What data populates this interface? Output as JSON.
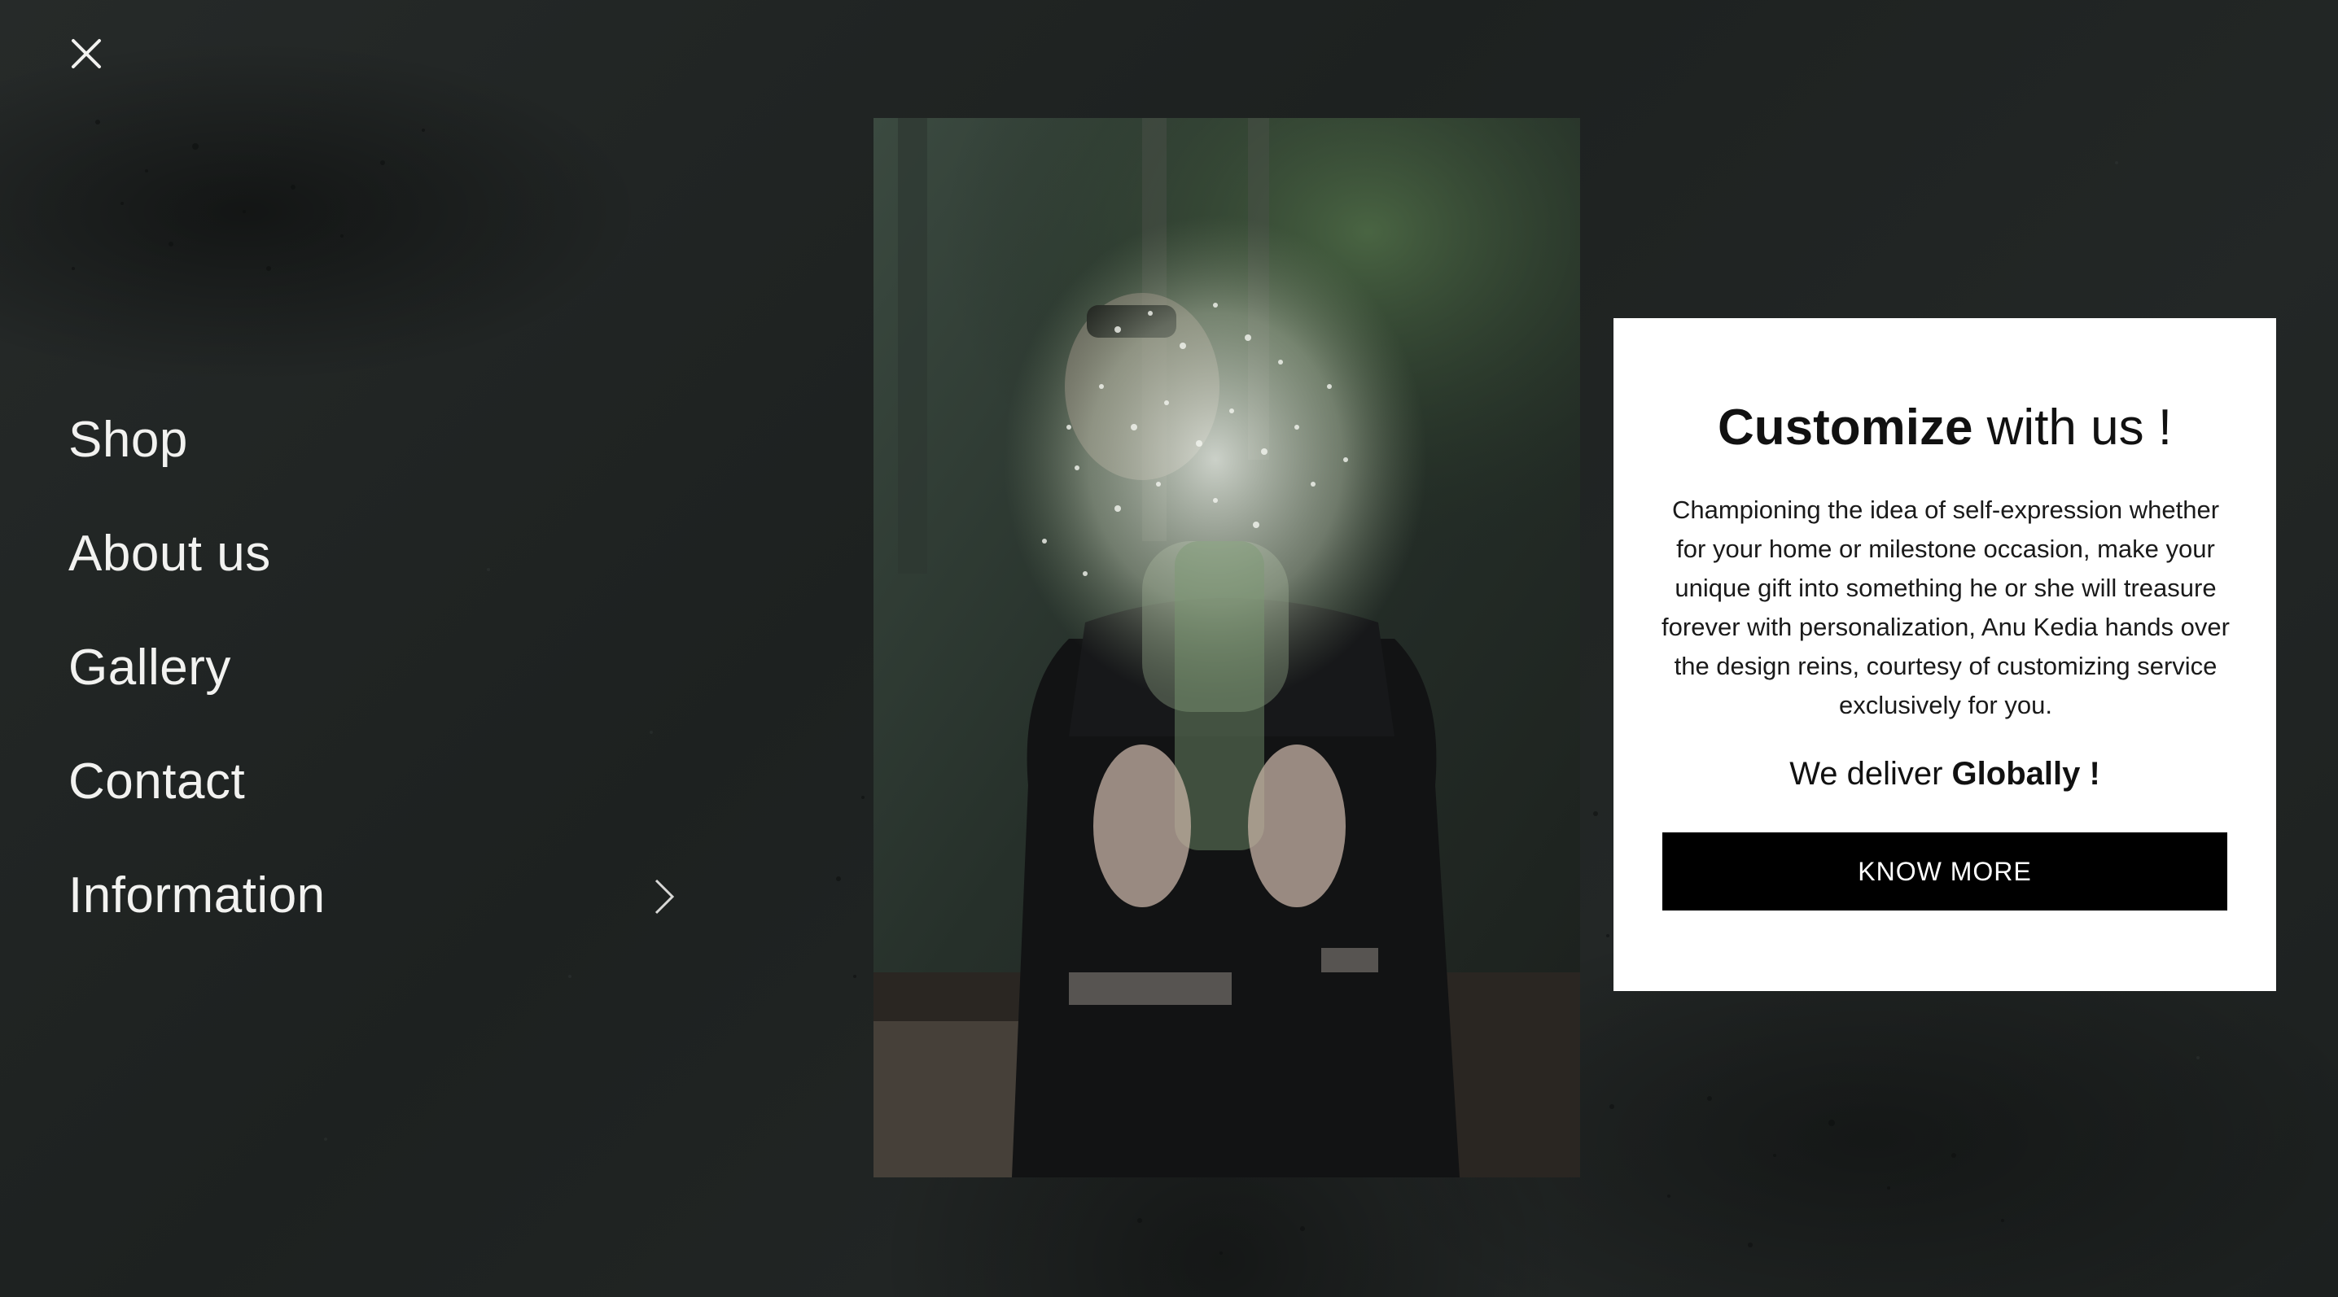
{
  "nav": {
    "close_icon": "close-icon",
    "items": [
      {
        "label": "Shop",
        "has_submenu": false
      },
      {
        "label": "About us",
        "has_submenu": false
      },
      {
        "label": "Gallery",
        "has_submenu": false
      },
      {
        "label": "Contact",
        "has_submenu": false
      },
      {
        "label": "Information",
        "has_submenu": true
      }
    ]
  },
  "promo": {
    "title_bold": "Customize",
    "title_rest": " with us !",
    "body": "Championing the idea of self-expression whether for your home or milestone occasion, make your unique gift into something he or she will treasure forever with personalization, Anu Kedia hands over the design reins, courtesy of customizing service exclusively for you.",
    "deliver_prefix": "We deliver ",
    "deliver_bold": "Globally !",
    "button_label": "KNOW MORE"
  },
  "colors": {
    "background": "#1f2322",
    "menu_text": "#f2f2f0",
    "card_background": "#ffffff",
    "button_background": "#000000",
    "button_text": "#ffffff"
  }
}
